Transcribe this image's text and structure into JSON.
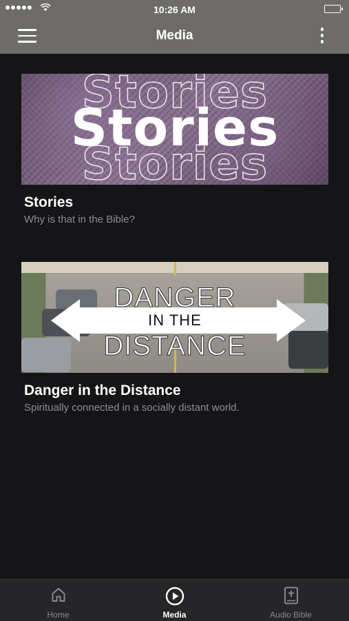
{
  "status_bar": {
    "time": "10:26 AM"
  },
  "header": {
    "title": "Media"
  },
  "media_items": [
    {
      "title": "Stories",
      "subtitle": "Why is that in the Bible?",
      "artwork_text": "Stories"
    },
    {
      "title": "Danger in the Distance",
      "subtitle": "Spiritually connected in a socially distant world.",
      "artwork_lines": [
        "DANGER",
        "IN THE",
        "DISTANCE"
      ]
    }
  ],
  "tabs": [
    {
      "label": "Home",
      "icon": "home-icon",
      "active": false
    },
    {
      "label": "Media",
      "icon": "play-circle-icon",
      "active": true
    },
    {
      "label": "Audio Bible",
      "icon": "bible-icon",
      "active": false
    }
  ],
  "colors": {
    "header_bg": "#6e6c69",
    "page_bg": "#151518",
    "tabbar_bg": "#262628",
    "subtitle": "#8d8d90"
  }
}
